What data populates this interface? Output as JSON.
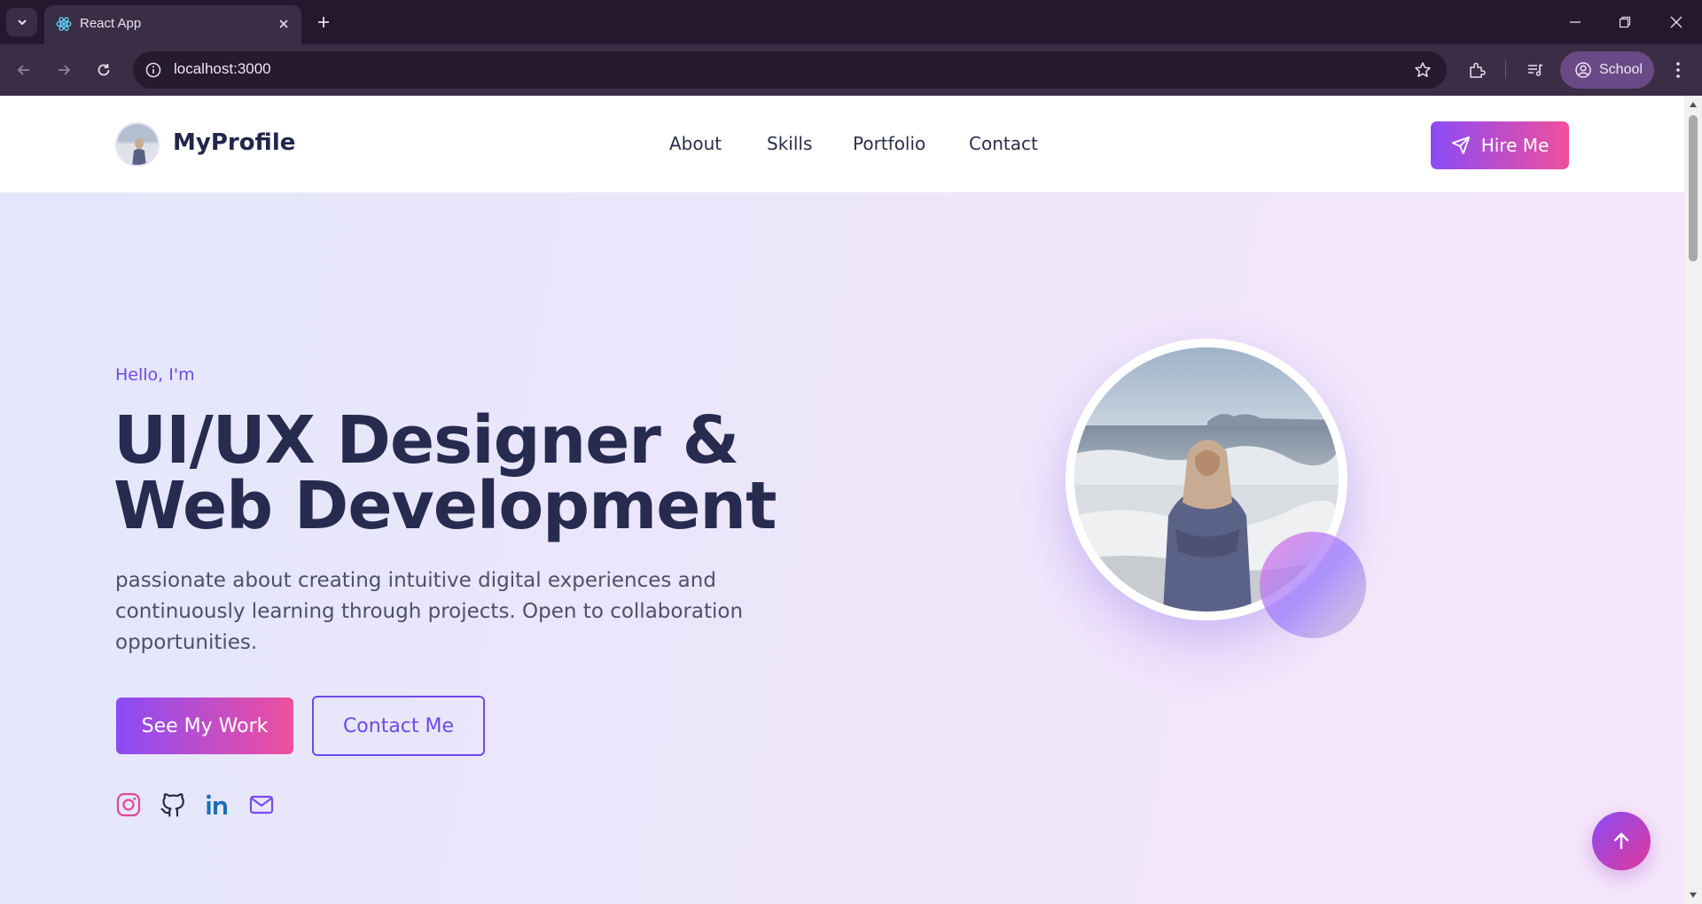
{
  "browser": {
    "tab_title": "React App",
    "url": "localhost:3000",
    "profile_label": "School",
    "icons": [
      "tab-dropdown-icon",
      "react-icon",
      "close-icon",
      "plus-icon",
      "minimize-icon",
      "restore-icon",
      "close-window-icon",
      "back-icon",
      "forward-icon",
      "reload-icon",
      "info-icon",
      "star-icon",
      "extensions-icon",
      "media-icon",
      "account-icon",
      "more-vert-icon"
    ]
  },
  "header": {
    "brand": "MyProfile",
    "nav": [
      "About",
      "Skills",
      "Portfolio",
      "Contact"
    ],
    "cta_label": "Hire Me"
  },
  "hero": {
    "greeting": "Hello, I'm",
    "headline_line1": "UI/UX Designer &",
    "headline_line2": "Web Development",
    "tagline": "passionate about creating intuitive digital experiences and continuously learning through projects. Open to collaboration opportunities.",
    "primary_button": "See My Work",
    "secondary_button": "Contact Me",
    "social_icons": [
      "instagram-icon",
      "github-icon",
      "linkedin-icon",
      "mail-icon"
    ]
  },
  "colors": {
    "accent_purple": "#7048e8",
    "gradient_start": "#8a4cf6",
    "gradient_end": "#f04f9d",
    "heading_navy": "#262b4f"
  }
}
